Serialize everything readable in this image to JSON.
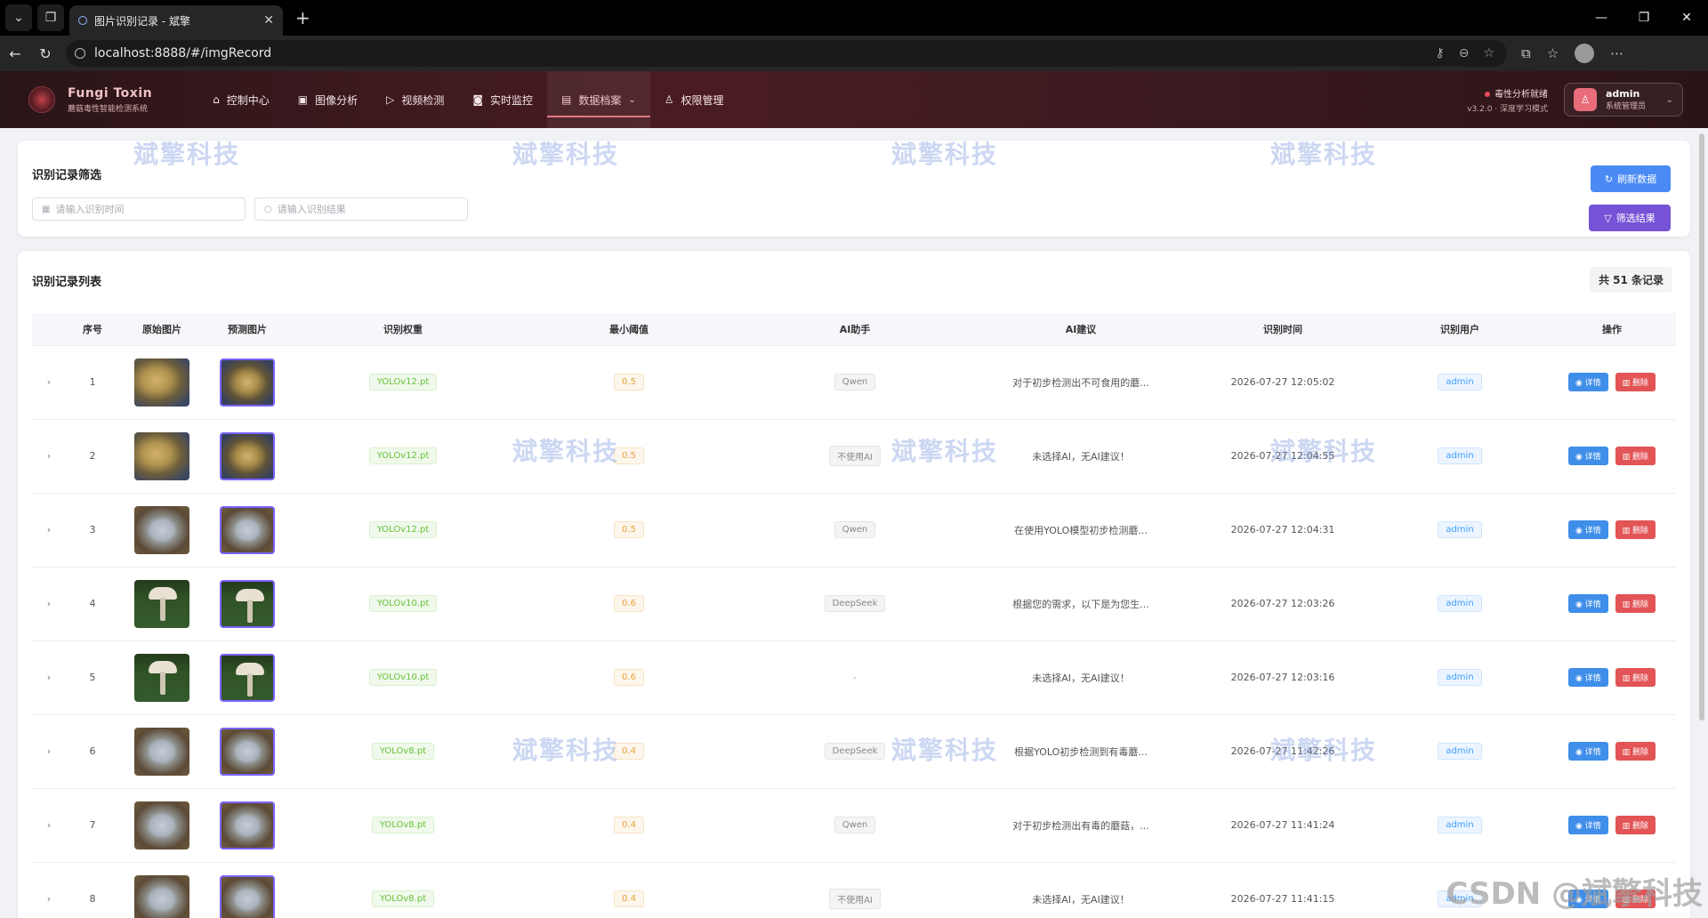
{
  "browser": {
    "tab_title": "图片识别记录 - 斌擎",
    "url": "localhost:8888/#/imgRecord"
  },
  "header": {
    "brand_name": "Fungi Toxin",
    "brand_sub": "蘑菇毒性智能检测系统",
    "nav": [
      {
        "label": "控制中心",
        "icon": "home-icon"
      },
      {
        "label": "图像分析",
        "icon": "image-icon"
      },
      {
        "label": "视频检测",
        "icon": "play-icon"
      },
      {
        "label": "实时监控",
        "icon": "camera-icon"
      },
      {
        "label": "数据档案",
        "icon": "document-icon",
        "active": true
      },
      {
        "label": "权限管理",
        "icon": "user-icon"
      }
    ],
    "status_text": "毒性分析就绪",
    "version_text": "v3.2.0 · 深度学习模式",
    "user_name": "admin",
    "user_role": "系统管理员"
  },
  "filter": {
    "title": "识别记录筛选",
    "time_placeholder": "请输入识别时间",
    "result_placeholder": "请输入识别结果",
    "refresh_label": "刷新数据",
    "filter_label": "筛选结果"
  },
  "list": {
    "title": "识别记录列表",
    "count_text": "共 51 条记录",
    "columns": [
      "序号",
      "原始图片",
      "预测图片",
      "识别权重",
      "最小阈值",
      "AI助手",
      "AI建议",
      "识别时间",
      "识别用户",
      "操作"
    ],
    "view_label": "详情",
    "delete_label": "删除",
    "rows": [
      {
        "idx": "1",
        "weight": "YOLOv12.pt",
        "conf": "0.5",
        "ai": "Qwen",
        "suggest": "对于初步检测出不可食用的蘑...",
        "time": "2026-07-27 12:05:02",
        "user": "admin",
        "img": "t-fungi",
        "pred": "t-fungi2"
      },
      {
        "idx": "2",
        "weight": "YOLOv12.pt",
        "conf": "0.5",
        "ai": "不使用AI",
        "suggest": "未选择AI，无AI建议！",
        "time": "2026-07-27 12:04:55",
        "user": "admin",
        "img": "t-fungi",
        "pred": "t-fungi2"
      },
      {
        "idx": "3",
        "weight": "YOLOv12.pt",
        "conf": "0.5",
        "ai": "Qwen",
        "suggest": "在使用YOLO模型初步检测蘑...",
        "time": "2026-07-27 12:04:31",
        "user": "admin",
        "img": "t-gray",
        "pred": "t-gray"
      },
      {
        "idx": "4",
        "weight": "YOLOv10.pt",
        "conf": "0.6",
        "ai": "DeepSeek",
        "suggest": "根据您的需求，以下是为您生...",
        "time": "2026-07-27 12:03:26",
        "user": "admin",
        "img": "t-mush",
        "pred": "t-mush"
      },
      {
        "idx": "5",
        "weight": "YOLOv10.pt",
        "conf": "0.6",
        "ai": "-",
        "suggest": "未选择AI，无AI建议！",
        "time": "2026-07-27 12:03:16",
        "user": "admin",
        "img": "t-mush",
        "pred": "t-mush"
      },
      {
        "idx": "6",
        "weight": "YOLOv8.pt",
        "conf": "0.4",
        "ai": "DeepSeek",
        "suggest": "根据YOLO初步检测到有毒蘑...",
        "time": "2026-07-27 11:42:26",
        "user": "admin",
        "img": "t-gray",
        "pred": "t-gray"
      },
      {
        "idx": "7",
        "weight": "YOLOv8.pt",
        "conf": "0.4",
        "ai": "Qwen",
        "suggest": "对于初步检测出有毒的蘑菇，...",
        "time": "2026-07-27 11:41:24",
        "user": "admin",
        "img": "t-gray",
        "pred": "t-gray"
      },
      {
        "idx": "8",
        "weight": "YOLOv8.pt",
        "conf": "0.4",
        "ai": "不使用AI",
        "suggest": "未选择AI，无AI建议！",
        "time": "2026-07-27 11:41:15",
        "user": "admin",
        "img": "t-gray",
        "pred": "t-gray"
      }
    ]
  },
  "watermark": "斌擎科技",
  "csdn_mark": "CSDN @斌擎科技",
  "colors": {
    "accent_blue": "#4a8af5",
    "accent_purple": "#7552d6",
    "header_bg": "#3a1a1f",
    "delete_red": "#e25456"
  }
}
